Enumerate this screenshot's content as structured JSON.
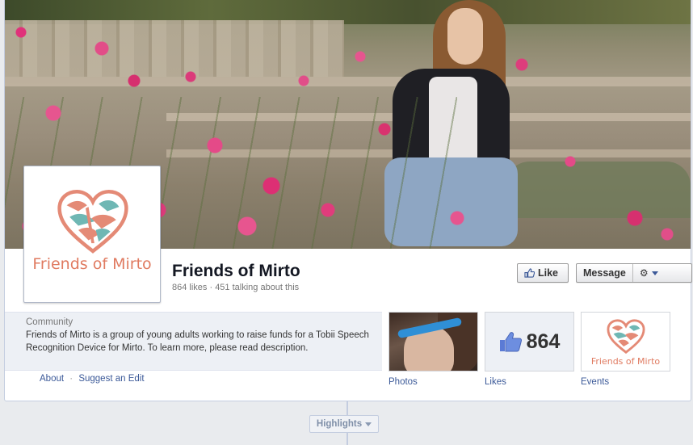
{
  "page": {
    "name": "Friends of Mirto",
    "stats": "864 likes · 451 talking about this",
    "logo_text": "Friends of Mirto"
  },
  "buttons": {
    "like": "Like",
    "message": "Message"
  },
  "about": {
    "category": "Community",
    "description": "Friends of Mirto is a group of young adults working to raise funds for a Tobii Speech Recognition Device for Mirto. To learn more, please read description.",
    "link_about": "About",
    "separator": "·",
    "link_suggest": "Suggest an Edit"
  },
  "apps": [
    {
      "label": "Photos"
    },
    {
      "label": "Likes",
      "count": "864"
    },
    {
      "label": "Events",
      "logo_text": "Friends of Mirto"
    }
  ],
  "timeline": {
    "highlights": "Highlights"
  },
  "colors": {
    "link": "#3b5998",
    "logo": "#e07b61",
    "heart_teal": "#6fb7b4",
    "heart_coral": "#e48a76"
  },
  "icons": [
    "thumbs-up-icon",
    "gear-icon",
    "chevron-down-icon",
    "heart-logo-icon"
  ]
}
